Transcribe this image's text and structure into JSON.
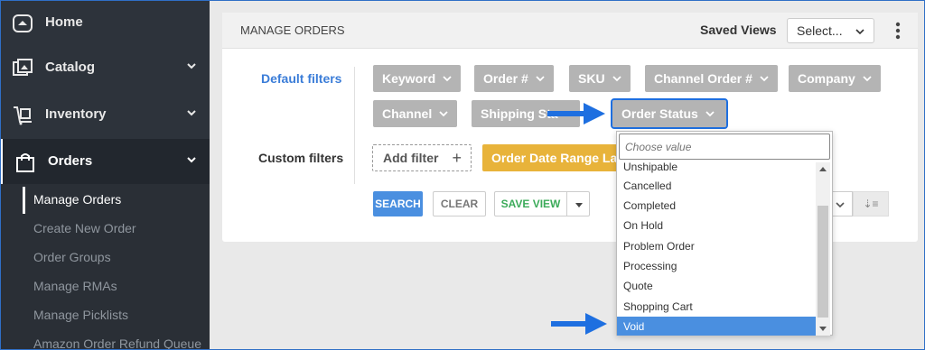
{
  "sidebar": {
    "items": [
      {
        "label": "Home",
        "icon": "home-icon"
      },
      {
        "label": "Catalog",
        "icon": "catalog-icon"
      },
      {
        "label": "Inventory",
        "icon": "inventory-icon"
      },
      {
        "label": "Orders",
        "icon": "bag-icon"
      }
    ],
    "subitems": [
      {
        "label": "Manage Orders"
      },
      {
        "label": "Create New Order"
      },
      {
        "label": "Order Groups"
      },
      {
        "label": "Manage RMAs"
      },
      {
        "label": "Manage Picklists"
      },
      {
        "label": "Amazon Order Refund Queue"
      }
    ]
  },
  "header": {
    "title": "MANAGE ORDERS",
    "saved_views_label": "Saved Views",
    "saved_views_value": "Select..."
  },
  "filters": {
    "default_label": "Default filters",
    "custom_label": "Custom filters",
    "default_chips": [
      {
        "label": "Keyword"
      },
      {
        "label": "Order #"
      },
      {
        "label": "SKU"
      },
      {
        "label": "Channel Order #"
      },
      {
        "label": "Company"
      },
      {
        "label": "Channel"
      },
      {
        "label": "Shipping Sta"
      },
      {
        "label": "Order Status"
      }
    ],
    "add_filter": "Add filter",
    "add_filter_plus": "+",
    "order_date_range": "Order Date Range La"
  },
  "actions": {
    "search": "SEARCH",
    "clear": "CLEAR",
    "save_view": "SAVE VIEW",
    "sort_icon": "⇣≡"
  },
  "dropdown": {
    "placeholder": "Choose value",
    "options": [
      "Unshipable",
      "Cancelled",
      "Completed",
      "On Hold",
      "Problem Order",
      "Processing",
      "Quote",
      "Shopping Cart",
      "Void"
    ],
    "highlighted": "Void"
  },
  "colors": {
    "accent": "#4a8fe0",
    "sidebar": "#2d333b",
    "chip": "#b4b4b4",
    "date_chip": "#e8b33a",
    "arrow": "#1e6fe0"
  }
}
